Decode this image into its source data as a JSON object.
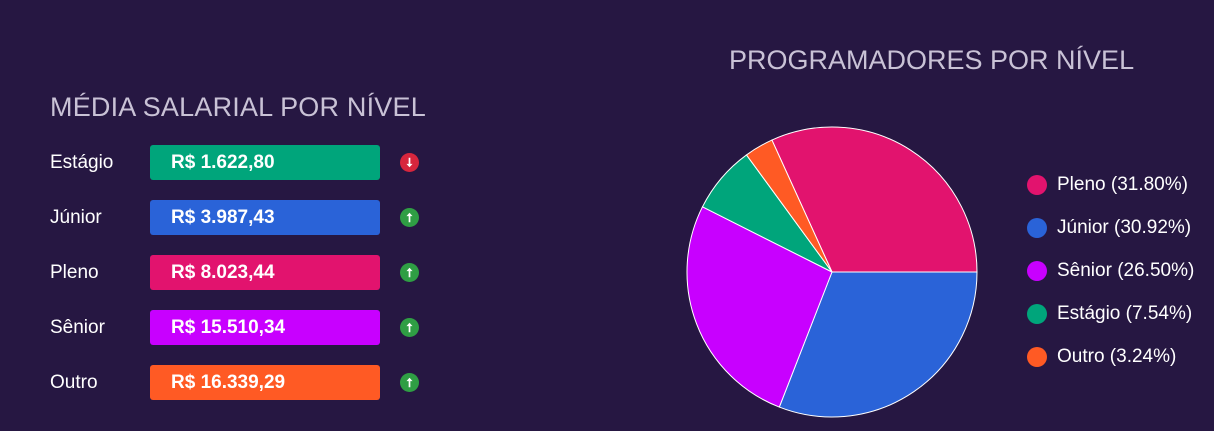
{
  "salary_panel": {
    "title": "MÉDIA SALARIAL POR NÍVEL",
    "rows": [
      {
        "level": "Estágio",
        "value": "R$ 1.622,80",
        "color": "#00a57b",
        "trend": "down",
        "trend_icon": "arrow-down-icon"
      },
      {
        "level": "Júnior",
        "value": "R$ 3.987,43",
        "color": "#2a63d8",
        "trend": "up",
        "trend_icon": "arrow-up-icon"
      },
      {
        "level": "Pleno",
        "value": "R$ 8.023,44",
        "color": "#e2136e",
        "trend": "up",
        "trend_icon": "arrow-up-icon"
      },
      {
        "level": "Sênior",
        "value": "R$ 15.510,34",
        "color": "#c800ff",
        "trend": "up",
        "trend_icon": "arrow-up-icon"
      },
      {
        "level": "Outro",
        "value": "R$ 16.339,29",
        "color": "#ff5a24",
        "trend": "up",
        "trend_icon": "arrow-up-icon"
      }
    ],
    "trend_colors": {
      "up": "#2f9e44",
      "down": "#d7263d"
    }
  },
  "chart_data": {
    "type": "pie",
    "title": "PROGRAMADORES POR NÍVEL",
    "slices": [
      {
        "label": "Pleno",
        "value": 31.8,
        "legend": "Pleno (31.80%)",
        "color": "#e2136e"
      },
      {
        "label": "Júnior",
        "value": 30.92,
        "legend": "Júnior (30.92%)",
        "color": "#2a63d8"
      },
      {
        "label": "Sênior",
        "value": 26.5,
        "legend": "Sênior (26.50%)",
        "color": "#c800ff"
      },
      {
        "label": "Estágio",
        "value": 7.54,
        "legend": "Estágio (7.54%)",
        "color": "#00a57b"
      },
      {
        "label": "Outro",
        "value": 3.24,
        "legend": "Outro (3.24%)",
        "color": "#ff5a24"
      }
    ],
    "legend_position": "right",
    "start_direction": "clockwise from 3 o'clock, ending with Pleno"
  }
}
